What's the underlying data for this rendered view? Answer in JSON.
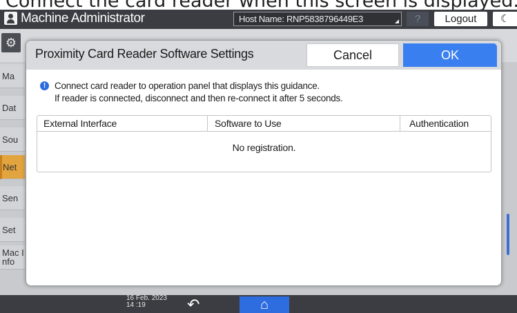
{
  "caption": "Connect the card reader when this screen is displayed.",
  "header": {
    "app_title": "Machine Administrator",
    "host_name": "Host Name: RNP5838796449E3",
    "help_label": "?",
    "logout_label": "Logout",
    "moon_glyph": "☾"
  },
  "background": {
    "gear_glyph": "⚙",
    "sidebar": [
      {
        "label": "Ma"
      },
      {
        "label": "Dat"
      },
      {
        "label": "Sou"
      },
      {
        "label": "Net"
      },
      {
        "label": "Sen"
      },
      {
        "label": "Set"
      },
      {
        "label": "Mac Info"
      }
    ]
  },
  "dialog": {
    "title": "Proximity Card Reader Software Settings",
    "cancel_label": "Cancel",
    "ok_label": "OK",
    "info_glyph": "!",
    "guidance_line1": "Connect card reader to operation panel that displays this guidance.",
    "guidance_line2": "If reader is connected, disconnect and then re-connect it after 5 seconds.",
    "table": {
      "columns": [
        "External Interface",
        "Software to Use",
        "Authentication"
      ],
      "empty_message": "No registration."
    }
  },
  "footer": {
    "date": "16 Feb. 2023",
    "time": "14 :19",
    "back_glyph": "↶",
    "home_glyph": "⌂"
  },
  "colors": {
    "header_bg": "#3b3d42",
    "ok_blue": "#3a7ff0",
    "active_orange": "#e2a43e",
    "info_blue": "#2d6ce0"
  }
}
